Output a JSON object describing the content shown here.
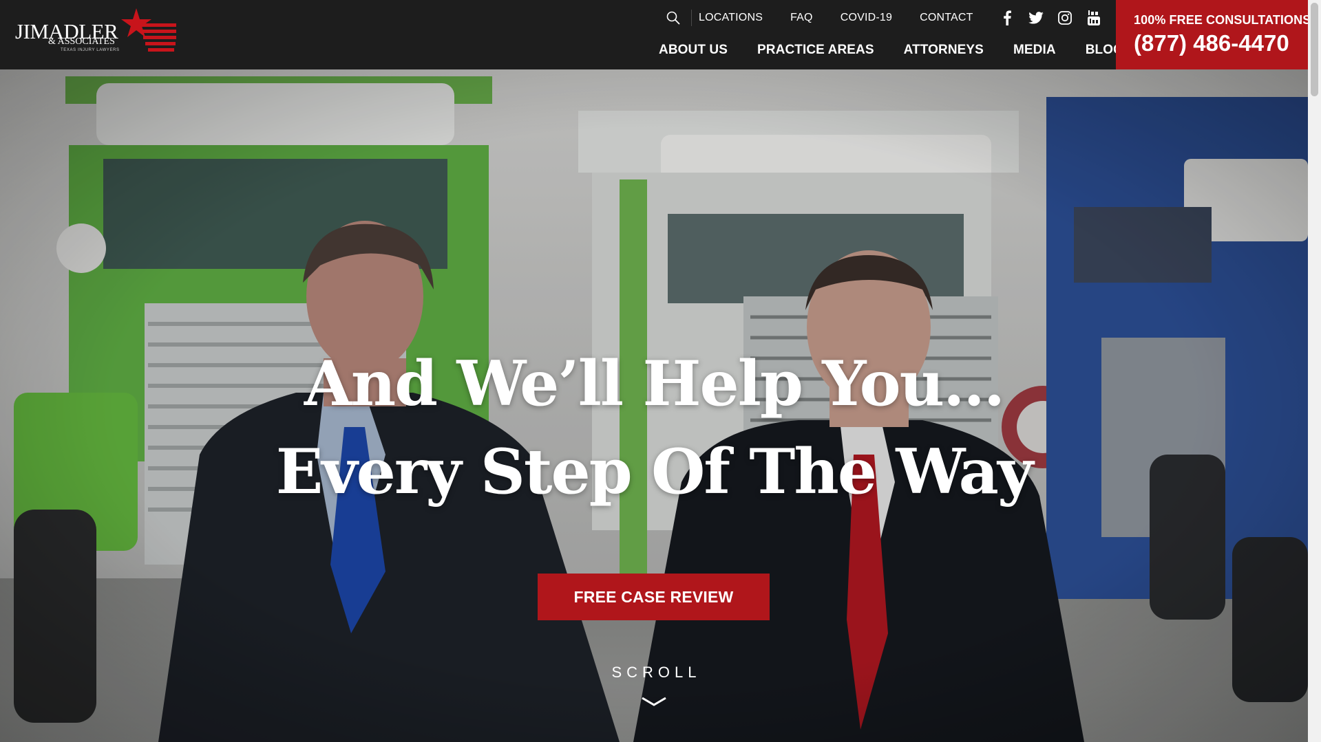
{
  "brand": {
    "logo_main": "JIMADLER",
    "logo_sub": "& ASSOCIATES",
    "logo_tagline": "TEXAS INJURY LAWYERS",
    "accent_color": "#b0161b",
    "header_bg": "#1d1d1d"
  },
  "utility_nav": {
    "search_icon": "search-icon",
    "links": [
      "LOCATIONS",
      "FAQ",
      "COVID-19",
      "CONTACT"
    ],
    "social_icons": [
      "facebook-icon",
      "twitter-icon",
      "instagram-icon",
      "youtube-icon"
    ]
  },
  "main_nav": {
    "links": [
      "ABOUT US",
      "PRACTICE AREAS",
      "ATTORNEYS",
      "MEDIA",
      "BLOG"
    ]
  },
  "consultation": {
    "label": "100% FREE CONSULTATIONS",
    "phone": "(877) 486-4470"
  },
  "hero": {
    "headline_line1": "And We’ll Help You…",
    "headline_line2": "Every Step Of The Way",
    "cta_label": "FREE CASE REVIEW",
    "scroll_label": "SCROLL",
    "scroll_icon": "chevron-down-icon"
  }
}
